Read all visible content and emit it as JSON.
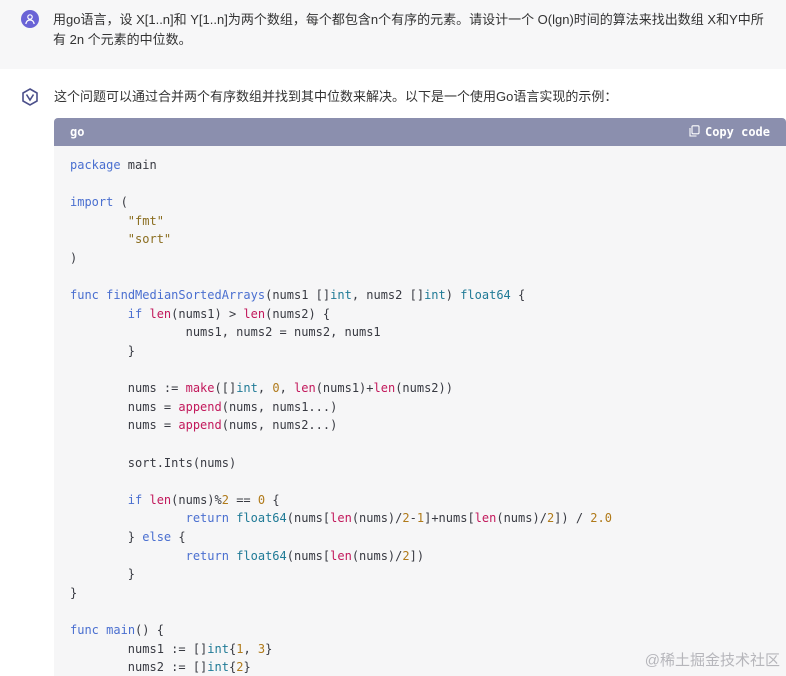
{
  "user_message": {
    "avatar_icon": "user-icon",
    "text": "用go语言，设 X[1..n]和 Y[1..n]为两个数组，每个都包含n个有序的元素。请设计一个 O(lgn)时间的算法来找出数组 X和Y中所有 2n 个元素的中位数。"
  },
  "assistant_message": {
    "avatar_icon": "assistant-logo-icon",
    "intro": "这个问题可以通过合并两个有序数组并找到其中位数来解决。以下是一个使用Go语言实现的示例："
  },
  "code_block": {
    "language": "go",
    "copy_label": "Copy code",
    "lines": [
      "package main",
      "",
      "import (",
      "        \"fmt\"",
      "        \"sort\"",
      ")",
      "",
      "func findMedianSortedArrays(nums1 []int, nums2 []int) float64 {",
      "        if len(nums1) > len(nums2) {",
      "                nums1, nums2 = nums2, nums1",
      "        }",
      "",
      "        nums := make([]int, 0, len(nums1)+len(nums2))",
      "        nums = append(nums, nums1...)",
      "        nums = append(nums, nums2...)",
      "",
      "        sort.Ints(nums)",
      "",
      "        if len(nums)%2 == 0 {",
      "                return float64(nums[len(nums)/2-1]+nums[len(nums)/2]) / 2.0",
      "        } else {",
      "                return float64(nums[len(nums)/2])",
      "        }",
      "}",
      "",
      "func main() {",
      "        nums1 := []int{1, 3}",
      "        nums2 := []int{2}"
    ]
  },
  "watermark": "@稀土掘金技术社区",
  "colors": {
    "header_bar": "#8b8fae",
    "code_background": "#f6f6f7",
    "user_row_background": "#f7f7f8"
  }
}
